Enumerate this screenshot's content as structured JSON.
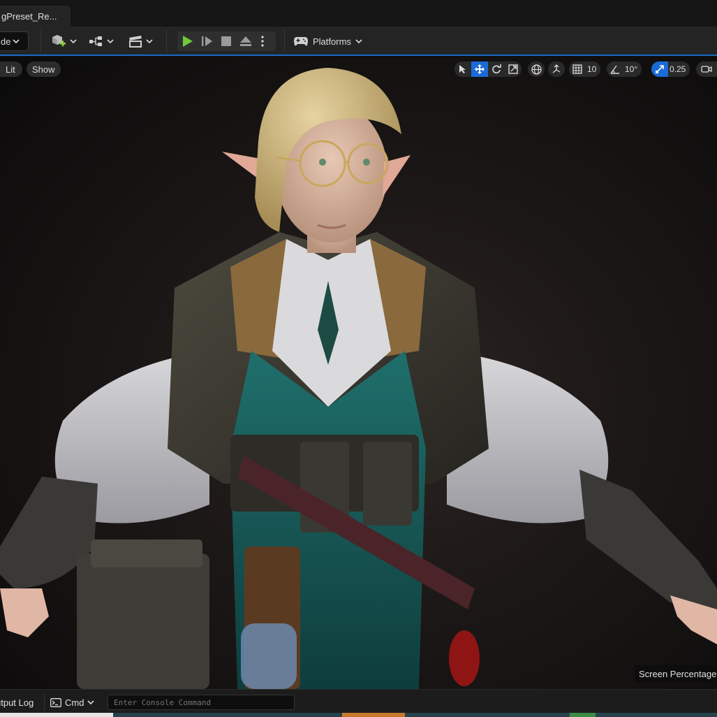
{
  "tab": {
    "title": "gPreset_Re..."
  },
  "toolbar": {
    "mode_label": "de",
    "platforms_label": "Platforms"
  },
  "viewport": {
    "lit_label": "Lit",
    "show_label": "Show",
    "grid_snap_value": "10",
    "rotation_snap_value": "10°",
    "scale_snap_value": "0.25",
    "screen_percentage_label": "Screen Percentage",
    "character": "elf-character-render"
  },
  "console": {
    "output_log_label": "utput Log",
    "cmd_label": "Cmd",
    "input_placeholder": "Enter Console Command"
  },
  "colors": {
    "accent": "#1b6bd6",
    "play": "#6fc93b",
    "add_actor": "#8bd13e"
  }
}
